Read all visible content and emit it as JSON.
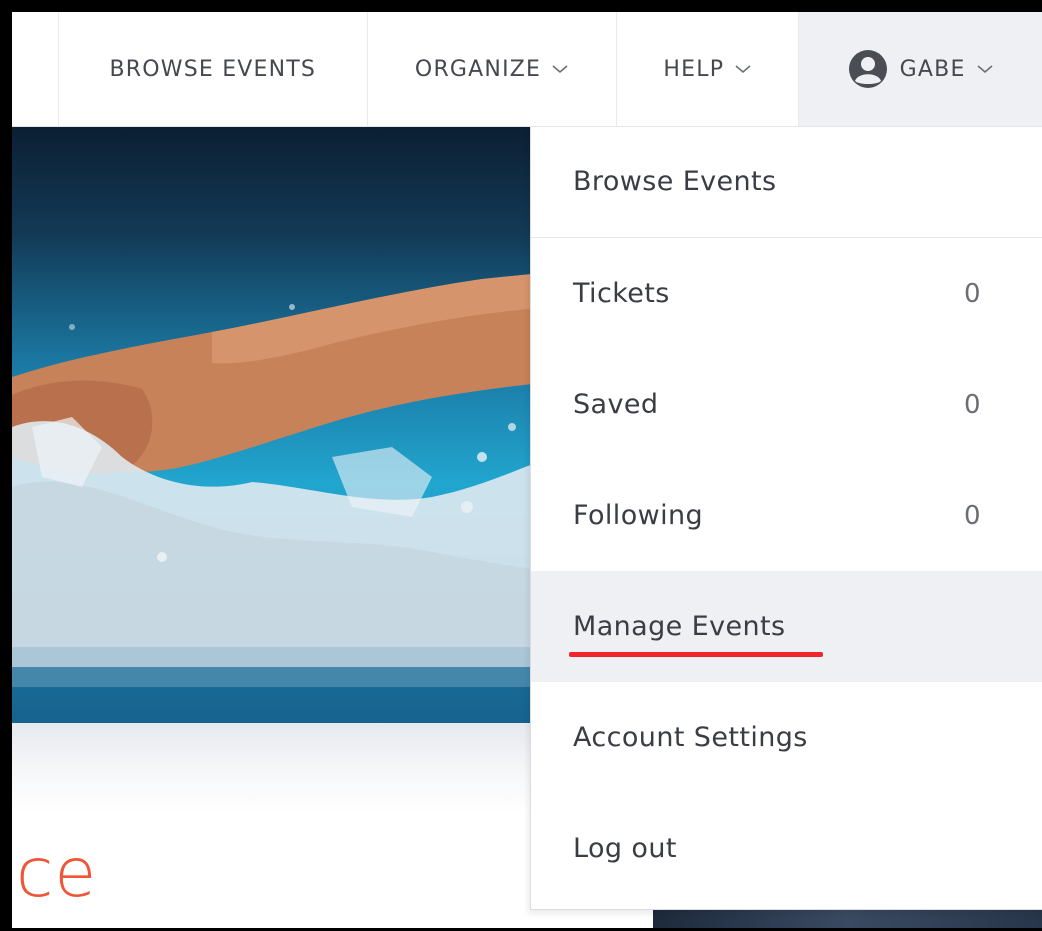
{
  "nav": {
    "browse_label": "BROWSE EVENTS",
    "organize_label": "ORGANIZE",
    "help_label": "HELP",
    "user_label": "GABE"
  },
  "dropdown": {
    "items": [
      {
        "label": "Browse Events",
        "count": ""
      },
      {
        "label": "Tickets",
        "count": "0"
      },
      {
        "label": "Saved",
        "count": "0"
      },
      {
        "label": "Following",
        "count": "0"
      },
      {
        "label": "Manage Events",
        "count": ""
      },
      {
        "label": "Account Settings",
        "count": ""
      },
      {
        "label": "Log out",
        "count": ""
      }
    ]
  },
  "hero": {
    "headline_fragment": "ce"
  },
  "colors": {
    "accent": "#f05537",
    "highlight_underline": "#f0262f",
    "active_bg": "#eff0f3",
    "text": "#3a3d44"
  },
  "icons": {
    "avatar": "user-avatar-icon",
    "chevron": "chevron-down-icon"
  }
}
